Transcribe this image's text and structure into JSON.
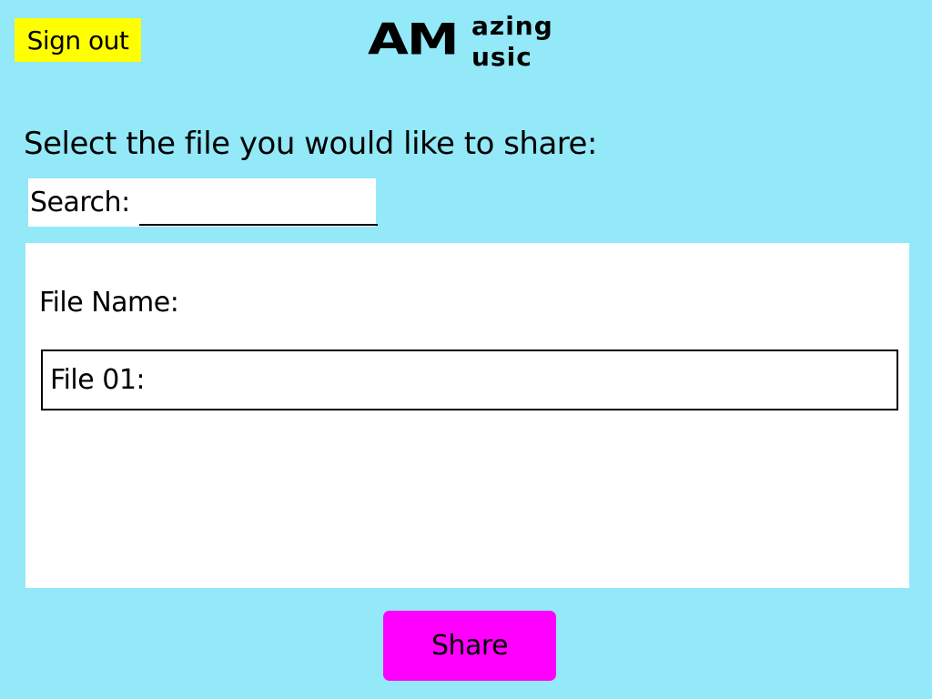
{
  "header": {
    "signout_label": "Sign out",
    "logo": {
      "big": "AM",
      "top": "azing",
      "bottom": "usic"
    }
  },
  "main": {
    "heading": "Select the file you would like to share:",
    "search": {
      "label": "Search:",
      "value": ""
    },
    "file_list": {
      "header": "File Name:",
      "files": [
        {
          "label": "File 01:"
        }
      ]
    },
    "share_label": "Share"
  },
  "colors": {
    "background": "#93e9f8",
    "signout_bg": "#ffff00",
    "share_bg": "#ff00ff",
    "panel_bg": "#ffffff"
  }
}
